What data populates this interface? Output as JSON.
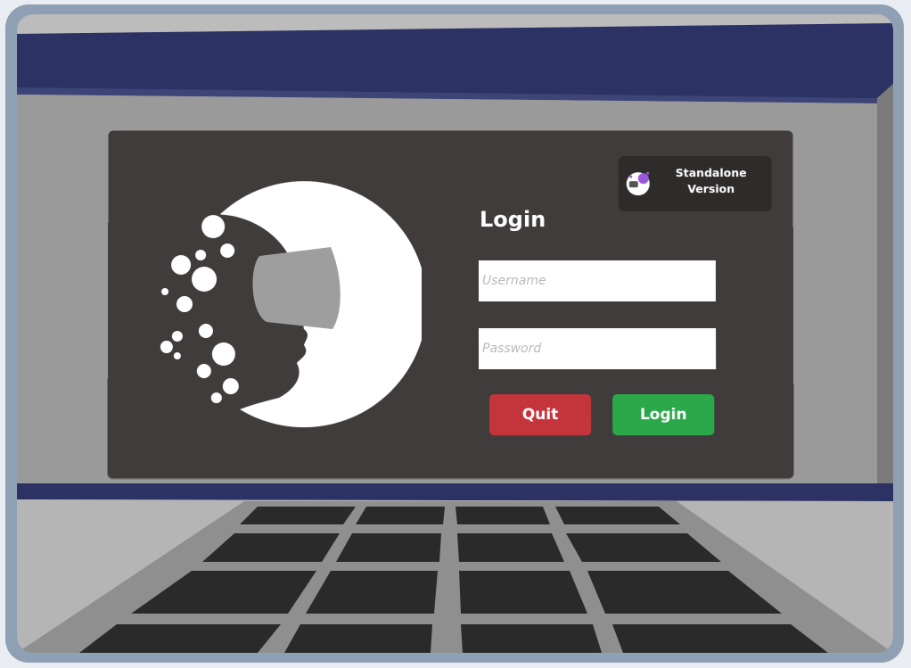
{
  "badge": {
    "line1": "Standalone",
    "line2": "Version",
    "icon": "vr-headset-globe-icon"
  },
  "login": {
    "title": "Login",
    "username_placeholder": "Username",
    "password_placeholder": "Password",
    "quit_label": "Quit",
    "login_label": "Login"
  },
  "logo": {
    "icon": "vr-headset-face-moon-logo"
  },
  "colors": {
    "panel": "#413c3c",
    "quit": "#c4343b",
    "login": "#2aa84a",
    "trim": "#2c3264"
  }
}
